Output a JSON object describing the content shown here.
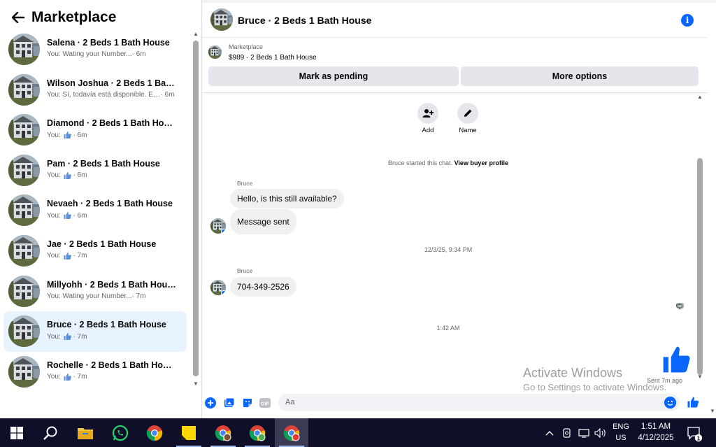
{
  "left_panel": {
    "title": "Marketplace",
    "conversations": [
      {
        "name": "Salena · 2 Beds 1 Bath House",
        "prefix": "You:",
        "preview": "Wating your Number...",
        "time": "· 6m",
        "like": false,
        "active": false
      },
      {
        "name": "Wilson Joshua · 2 Beds 1 Bath House",
        "prefix": "You:",
        "preview": "Sí, todavía está disponible. En...",
        "time": "· 6m",
        "like": false,
        "active": false
      },
      {
        "name": "Diamond · 2 Beds 1 Bath House",
        "prefix": "You:",
        "preview": "",
        "time": "· 6m",
        "like": true,
        "active": false
      },
      {
        "name": "Pam · 2 Beds 1 Bath House",
        "prefix": "You:",
        "preview": "",
        "time": "· 6m",
        "like": true,
        "active": false
      },
      {
        "name": "Nevaeh · 2 Beds 1 Bath House",
        "prefix": "You:",
        "preview": "",
        "time": "· 6m",
        "like": true,
        "active": false
      },
      {
        "name": "Jae · 2 Beds 1 Bath House",
        "prefix": "You:",
        "preview": "",
        "time": "· 7m",
        "like": true,
        "active": false
      },
      {
        "name": "Millyohh · 2 Beds 1 Bath House",
        "prefix": "You:",
        "preview": "Wating your Number...",
        "time": "· 7m",
        "like": false,
        "active": false
      },
      {
        "name": "Bruce · 2 Beds 1 Bath House",
        "prefix": "You:",
        "preview": "",
        "time": "· 7m",
        "like": true,
        "active": true
      },
      {
        "name": "Rochelle · 2 Beds 1 Bath House",
        "prefix": "You:",
        "preview": "",
        "time": "· 7m",
        "like": true,
        "active": false
      }
    ]
  },
  "chat": {
    "title": "Bruce · 2 Beds 1 Bath House",
    "listing": {
      "source": "Marketplace",
      "price_title": "$989 · 2 Beds 1 Bath House",
      "pending_label": "Mark as pending",
      "more_label": "More options"
    },
    "actions": {
      "add_label": "Add",
      "name_label": "Name"
    },
    "started_text": "Bruce started this chat.",
    "buyer_profile_link": "View buyer profile",
    "messages": {
      "group1_sender": "Bruce",
      "msg1": "Hello, is this still available?",
      "msg2": "Message sent",
      "timestamp1": "12/3/25, 9:34 PM",
      "group2_sender": "Bruce",
      "msg3": "704-349-2526",
      "timestamp2": "1:42 AM",
      "sent_status": "Sent 7m ago"
    },
    "composer": {
      "placeholder": "Aa"
    }
  },
  "watermark": {
    "line1": "Activate Windows",
    "line2": "Go to Settings to activate Windows."
  },
  "taskbar": {
    "lang_line1": "ENG",
    "lang_line2": "US",
    "time": "1:51 AM",
    "date": "4/12/2025",
    "notification_count": "1"
  },
  "colors": {
    "accent": "#0866ff",
    "active_row": "#e7f3ff",
    "bubble": "#f0f0f0",
    "button": "#e4e6eb",
    "taskbar": "#0f0f2a"
  }
}
